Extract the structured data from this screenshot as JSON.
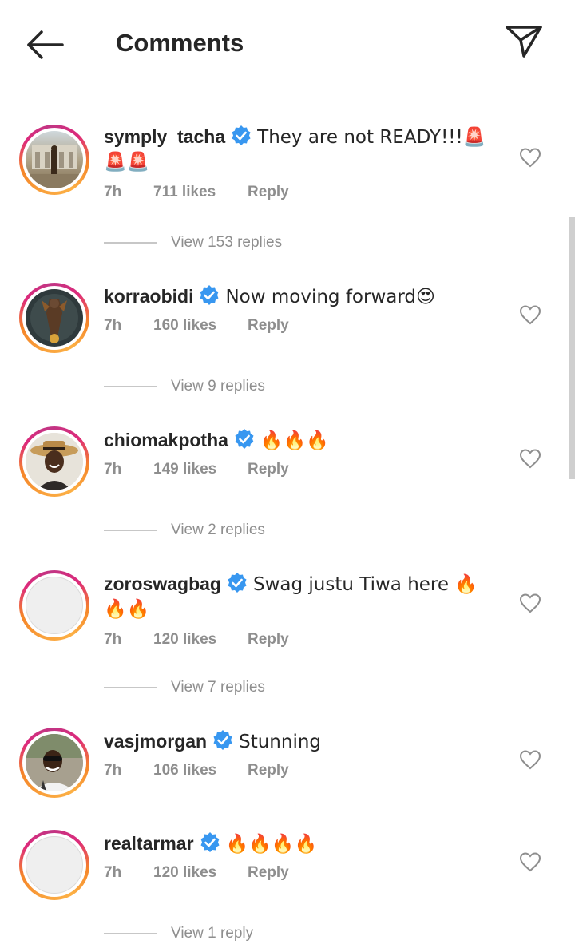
{
  "header": {
    "title": "Comments",
    "back_icon": "arrow-left-icon",
    "share_icon": "paper-plane-icon"
  },
  "colors": {
    "verified": "#3897f0",
    "meta_text": "#8e8e8e",
    "ring_gradient": [
      "#f58529",
      "#dd2a7b",
      "#c13584",
      "#fcb045"
    ]
  },
  "comments": [
    {
      "username": "symply_tacha",
      "verified": true,
      "text": "They are not READY!!!🚨🚨🚨",
      "time": "7h",
      "likes": "711 likes",
      "reply": "Reply",
      "view_replies": "View 153 replies"
    },
    {
      "username": "korraobidi",
      "verified": true,
      "text": "Now moving forward😍",
      "time": "7h",
      "likes": "160 likes",
      "reply": "Reply",
      "view_replies": "View 9 replies"
    },
    {
      "username": "chiomakpotha",
      "verified": true,
      "text": "🔥🔥🔥",
      "time": "7h",
      "likes": "149 likes",
      "reply": "Reply",
      "view_replies": "View 2 replies"
    },
    {
      "username": "zoroswagbag",
      "verified": true,
      "text": "Swag justu Tiwa here 🔥🔥🔥",
      "time": "7h",
      "likes": "120 likes",
      "reply": "Reply",
      "view_replies": "View 7 replies"
    },
    {
      "username": "vasjmorgan",
      "verified": true,
      "text": "Stunning",
      "time": "7h",
      "likes": "106 likes",
      "reply": "Reply"
    },
    {
      "username": "realtarmar",
      "verified": true,
      "text": "🔥🔥🔥🔥",
      "time": "7h",
      "likes": "120 likes",
      "reply": "Reply",
      "view_replies": "View 1 reply"
    }
  ]
}
